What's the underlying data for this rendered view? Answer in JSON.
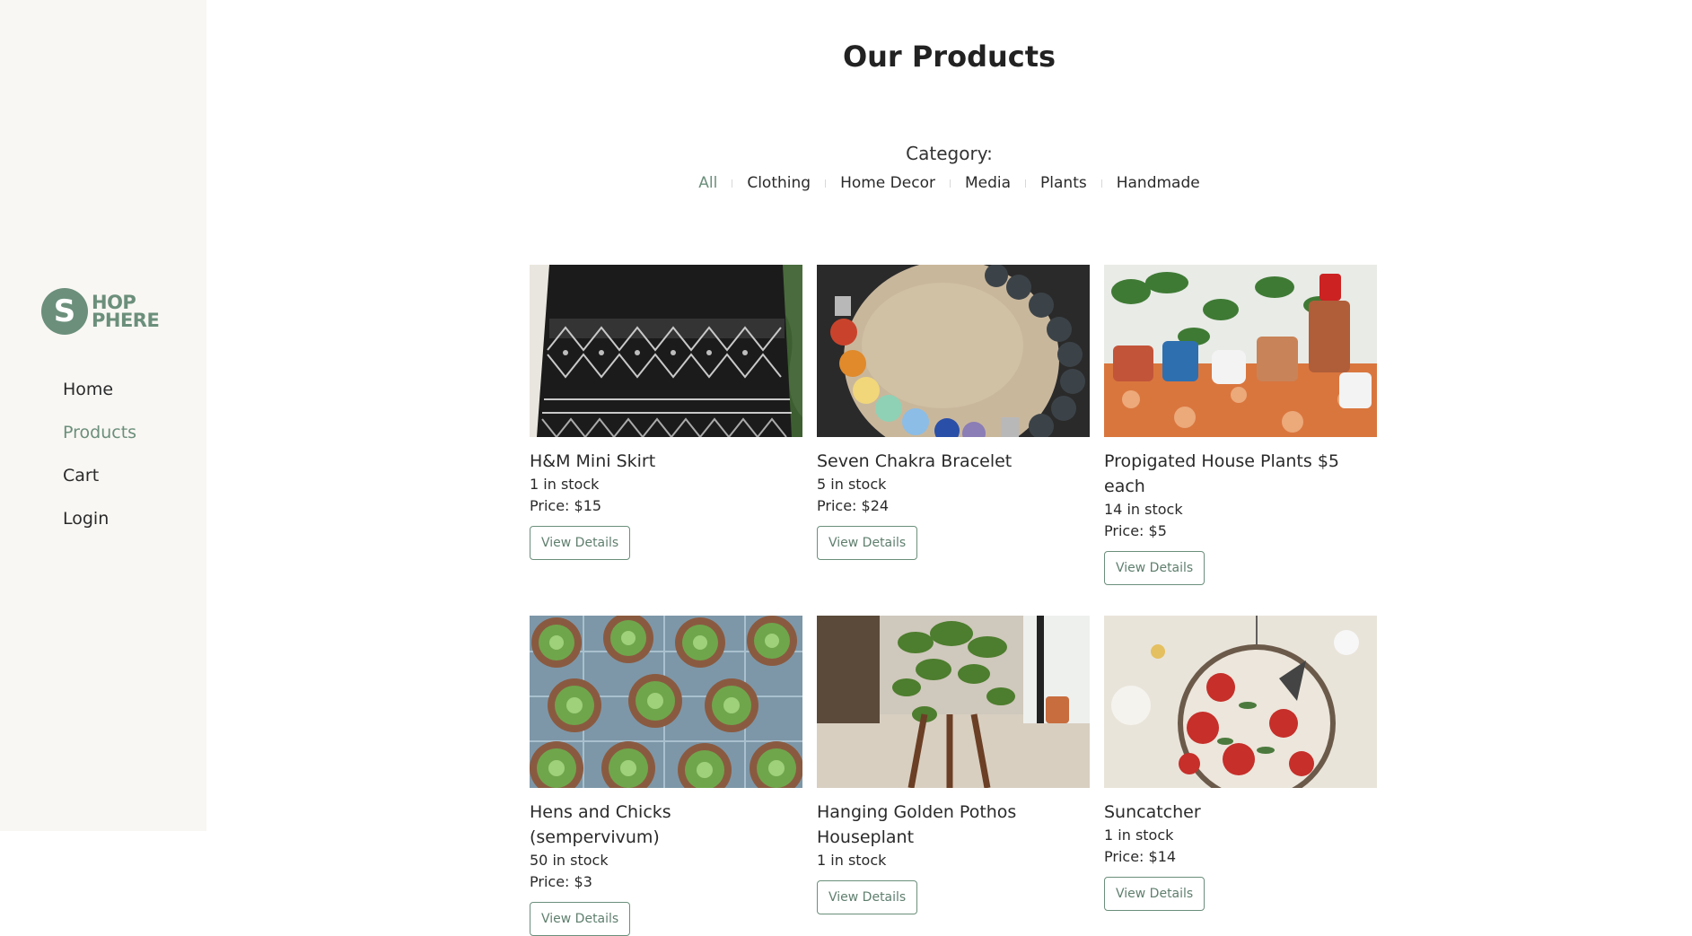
{
  "brand": {
    "letter": "S",
    "line1": "HOP",
    "line2": "PHERE"
  },
  "nav": {
    "items": [
      {
        "label": "Home",
        "active": false
      },
      {
        "label": "Products",
        "active": true
      },
      {
        "label": "Cart",
        "active": false
      },
      {
        "label": "Login",
        "active": false
      }
    ]
  },
  "page": {
    "title": "Our Products",
    "category_label": "Category:"
  },
  "filters": [
    {
      "label": "All",
      "active": true
    },
    {
      "label": "Clothing"
    },
    {
      "label": "Home Decor"
    },
    {
      "label": "Media"
    },
    {
      "label": "Plants"
    },
    {
      "label": "Handmade"
    }
  ],
  "products": [
    {
      "name": "H&M Mini Skirt",
      "stock": "1 in stock",
      "price": "Price: $15",
      "button": "View Details",
      "image": "black-embroidered-skirt"
    },
    {
      "name": "Seven Chakra Bracelet",
      "stock": "5 in stock",
      "price": "Price: $24",
      "button": "View Details",
      "image": "beaded-bracelet-on-stone"
    },
    {
      "name": "Propigated House Plants $5 each",
      "stock": "14 in stock",
      "price": "Price: $5",
      "button": "View Details",
      "image": "potted-plants-table"
    },
    {
      "name": "Hens and Chicks (sempervivum)",
      "stock": "50 in stock",
      "price": "Price: $3",
      "button": "View Details",
      "image": "succulents-in-pots"
    },
    {
      "name": "Hanging Golden Pothos Houseplant",
      "stock": "1 in stock",
      "price": "",
      "button": "View Details",
      "image": "pothos-on-stand"
    },
    {
      "name": "Suncatcher",
      "stock": "1 in stock",
      "price": "Price: $14",
      "button": "View Details",
      "image": "stained-glass-suncatcher"
    }
  ],
  "colors": {
    "accent": "#6b8f7b",
    "sidebar_bg": "#f9f7f3",
    "text": "#2a2a2a"
  }
}
